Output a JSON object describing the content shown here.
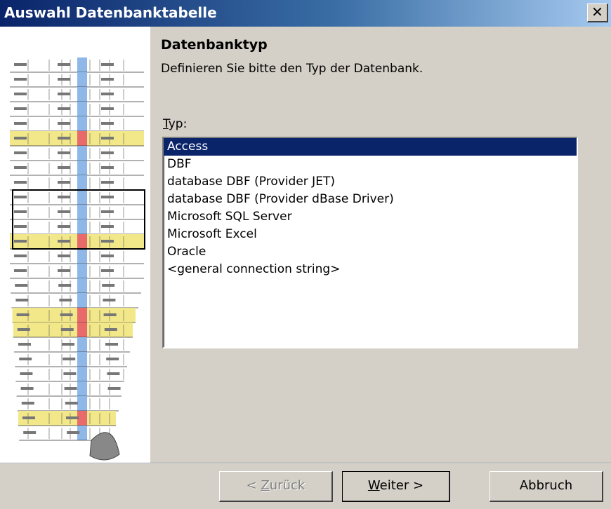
{
  "window": {
    "title": "Auswahl Datenbanktabelle"
  },
  "icons": {
    "close": "close-icon"
  },
  "page": {
    "heading": "Datenbanktyp",
    "description": "Definieren Sie bitte den Typ der Datenbank.",
    "type_label_accel": "T",
    "type_label_rest": "yp:"
  },
  "listbox": {
    "selected_index": 0,
    "items": [
      "Access",
      "DBF",
      "database DBF (Provider JET)",
      "database DBF (Provider dBase Driver)",
      "Microsoft SQL Server",
      "Microsoft Excel",
      "Oracle",
      "<general connection string>"
    ]
  },
  "buttons": {
    "back_prefix": "< ",
    "back_accel": "Z",
    "back_rest": "urück",
    "next_accel": "W",
    "next_rest": "eiter >",
    "cancel": "Abbruch"
  },
  "colors": {
    "title_start": "#0a246a",
    "title_end": "#a6caf0",
    "selection": "#0a246a",
    "face": "#d4d0c8",
    "highlight_yellow": "#f2e88a",
    "highlight_blue": "#8fb8e8",
    "highlight_red": "#e86a6a"
  }
}
